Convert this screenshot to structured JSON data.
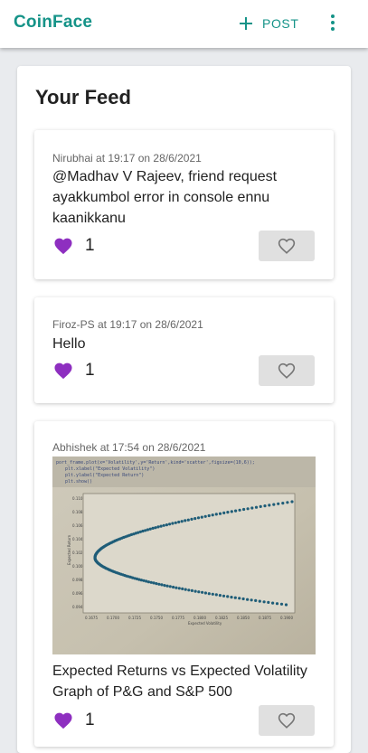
{
  "appbar": {
    "brand": "CoinFace",
    "post_label": "POST",
    "accent": "#159388"
  },
  "feed": {
    "title": "Your Feed",
    "posts": [
      {
        "meta": "Nirubhai at 19:17 on 28/6/2021",
        "text": "@Madhav V Rajeev, friend request ayakkumbol error in console ennu kaanikkanu",
        "likes": "1"
      },
      {
        "meta": "Firoz-PS at 19:17 on 28/6/2021",
        "text": "Hello",
        "likes": "1"
      },
      {
        "meta": "Abhishek at 17:54 on 28/6/2021",
        "text": "Expected Returns vs Expected Volatility Graph of P&G and S&P 500",
        "likes": "1",
        "image": {
          "code_lines": [
            "port_frame.plot(x='Volatility',y='Return',kind='scatter',figsize=(10,6));",
            "plt.xlabel(\"Expected Volatility\")",
            "plt.ylabel(\"Expected Return\")",
            "plt.show()"
          ],
          "y_ticks": [
            "0.110",
            "0.108",
            "0.106",
            "0.104",
            "0.102",
            "0.100",
            "0.098",
            "0.096",
            "0.094"
          ],
          "x_ticks": [
            "0.1675",
            "0.1700",
            "0.1725",
            "0.1750",
            "0.1775",
            "0.1800",
            "0.1825",
            "0.1850",
            "0.1875",
            "0.1900"
          ],
          "xlabel": "Expected Volatility",
          "ylabel": "Expected Return"
        }
      }
    ]
  },
  "colors": {
    "heart": "#8e2fc0",
    "like_btn": "#e0e0e0"
  }
}
